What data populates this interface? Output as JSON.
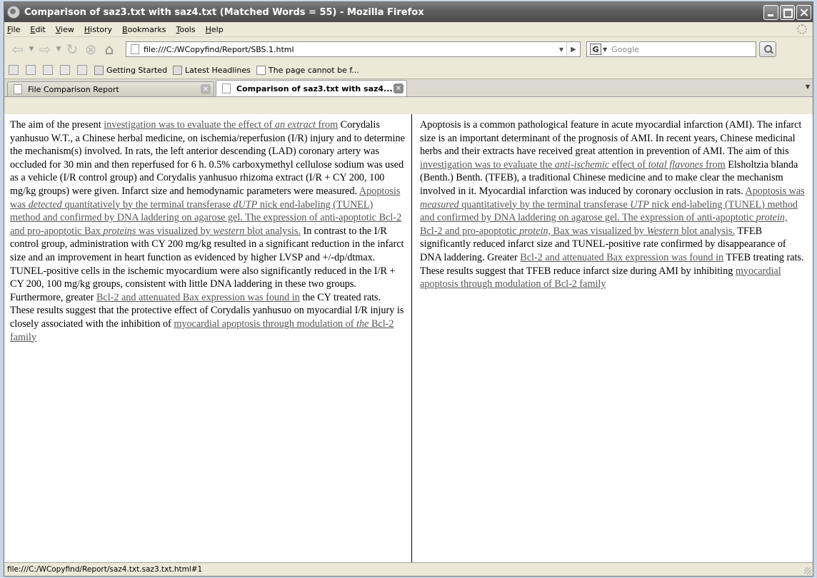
{
  "window": {
    "title": "Comparison of saz3.txt with saz4.txt (Matched Words = 55) - Mozilla Firefox"
  },
  "menu": [
    "File",
    "Edit",
    "View",
    "History",
    "Bookmarks",
    "Tools",
    "Help"
  ],
  "nav": {
    "url": "file:///C:/WCopyfind/Report/SBS.1.html",
    "search_placeholder": "Google"
  },
  "bookmarks": [
    "Getting Started",
    "Latest Headlines",
    "The page cannot be f..."
  ],
  "tabs": [
    {
      "label": "File Comparison Report",
      "active": false
    },
    {
      "label": "Comparison of saz3.txt with saz4...",
      "active": true
    }
  ],
  "left_doc": {
    "t1": "The aim of the present ",
    "m1": "investigation was to evaluate the effect of ",
    "m1i": "an extract",
    "m1b": " from",
    "t2": " Corydalis yanhusuo W.T., a Chinese herbal medicine, on ischemia/reperfusion (I/R) injury and to determine the mechanism(s) involved. In rats, the left anterior descending (LAD) coronary artery was occluded for 30 min and then reperfused for 6 h. 0.5% carboxymethyl cellulose sodium was used as a vehicle (I/R control group) and Corydalis yanhusuo rhizoma extract (I/R + CY 200, 100 mg/kg groups) were given. Infarct size and hemodynamic parameters were measured. ",
    "m2a": "Apoptosis was ",
    "m2i": "detected",
    "m2b": " quantitatively by the terminal transferase ",
    "m2i2": "dUTP",
    "m2c": " nick end-labeling (TUNEL) method and confirmed by DNA laddering on agarose gel. The expression of anti-apoptotic Bcl-2 and pro-apoptotic Bax ",
    "m2i3": "proteins",
    "m2d": " was visualized by ",
    "m2i4": "western",
    "m2e": " blot analysis.",
    "t3": " In contrast to the I/R control group, administration with CY 200 mg/kg resulted in a significant reduction in the infarct size and an improvement in heart function as evidenced by higher LVSP and +/-dp/dtmax. TUNEL-positive cells in the ischemic myocardium were also significantly reduced in the I/R + CY 200, 100 mg/kg groups, consistent with little DNA laddering in these two groups. Furthermore, greater ",
    "m3": "Bcl-2 and attenuated Bax expression was found in",
    "t4": " the CY treated rats. These results suggest that the protective effect of Corydalis yanhusuo on myocardial I/R injury is closely associated with the inhibition of ",
    "m4a": "myocardial apoptosis through modulation of ",
    "m4i": "the",
    "m4b": " Bcl-2 family"
  },
  "right_doc": {
    "t1": "Apoptosis is a common pathological feature in acute myocardial infarction (AMI). The infarct size is an important determinant of the prognosis of AMI. In recent years, Chinese medicinal herbs and their extracts have received great attention in prevention of AMI. The aim of this ",
    "m1a": "investigation was to evaluate the ",
    "m1i": "anti-ischemic",
    "m1b": " effect of ",
    "m1i2": "total flavones",
    "m1c": " from",
    "t2": " Elsholtzia blanda (Benth.) Benth. (TFEB), a traditional Chinese medicine and to make clear the mechanism involved in it. Myocardial infarction was induced by coronary occlusion in rats. ",
    "m2a": "Apoptosis was ",
    "m2i": "measured",
    "m2b": " quantitatively by the terminal transferase ",
    "m2i2": "UTP",
    "m2c": " nick end-labeling (TUNEL) method and confirmed by DNA laddering on agarose gel. The expression of anti-apoptotic ",
    "m2i3": "protein,",
    "m2d": " Bcl-2 and pro-apoptotic ",
    "m2i4": "protein,",
    "m2e": " Bax was visualized by ",
    "m2i5": "Western",
    "m2f": " blot analysis.",
    "t3": " TFEB significantly reduced infarct size and TUNEL-positive rate confirmed by disappearance of DNA laddering. Greater ",
    "m3": "Bcl-2 and attenuated Bax expression was found in",
    "t4": " TFEB treating rats. These results suggest that TFEB reduce infarct size during AMI by inhibiting ",
    "m4": "myocardial apoptosis through modulation of Bcl-2 family"
  },
  "status": "file:///C:/WCopyfind/Report/saz4.txt.saz3.txt.html#1"
}
